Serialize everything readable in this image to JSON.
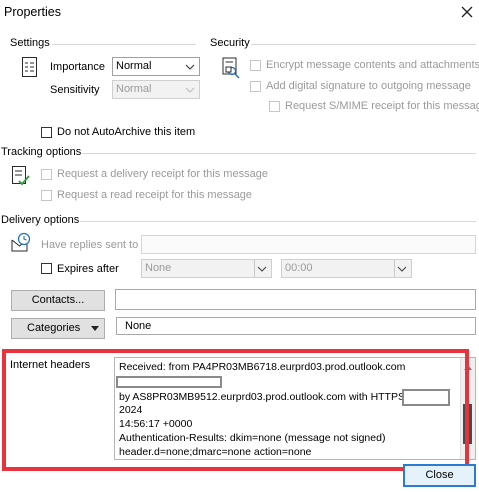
{
  "window": {
    "title": "Properties"
  },
  "settings": {
    "label": "Settings",
    "importance_label": "Importance",
    "importance_value": "Normal",
    "sensitivity_label": "Sensitivity",
    "sensitivity_value": "Normal",
    "autoarchive_label": "Do not AutoArchive this item"
  },
  "security": {
    "label": "Security",
    "encrypt_label": "Encrypt message contents and attachments",
    "signature_label": "Add digital signature to outgoing message",
    "smime_label": "Request S/MIME receipt for this message"
  },
  "tracking": {
    "label": "Tracking options",
    "delivery_receipt_label": "Request a delivery receipt for this message",
    "read_receipt_label": "Request a read receipt for this message"
  },
  "delivery": {
    "label": "Delivery options",
    "replies_label": "Have replies sent to",
    "replies_value": "",
    "expires_label": "Expires after",
    "expires_date": "None",
    "expires_time": "00:00"
  },
  "contacts": {
    "button_label": "Contacts...",
    "value": ""
  },
  "categories": {
    "button_label": "Categories",
    "value": "None"
  },
  "internet_headers": {
    "label": "Internet headers",
    "lines": [
      "Received: from PA4PR03MB6718.eurprd03.prod.outlook.com",
      "",
      " by AS8PR03MB9512.eurprd03.prod.outlook.com with HTTPS",
      "2024",
      " 14:56:17 +0000",
      "Authentication-Results: dkim=none (message not signed)",
      " header.d=none;dmarc=none action=none"
    ]
  },
  "footer": {
    "close_label": "Close"
  },
  "colors": {
    "highlight_frame": "#e8323c",
    "focus_border": "#2a7bd4"
  }
}
